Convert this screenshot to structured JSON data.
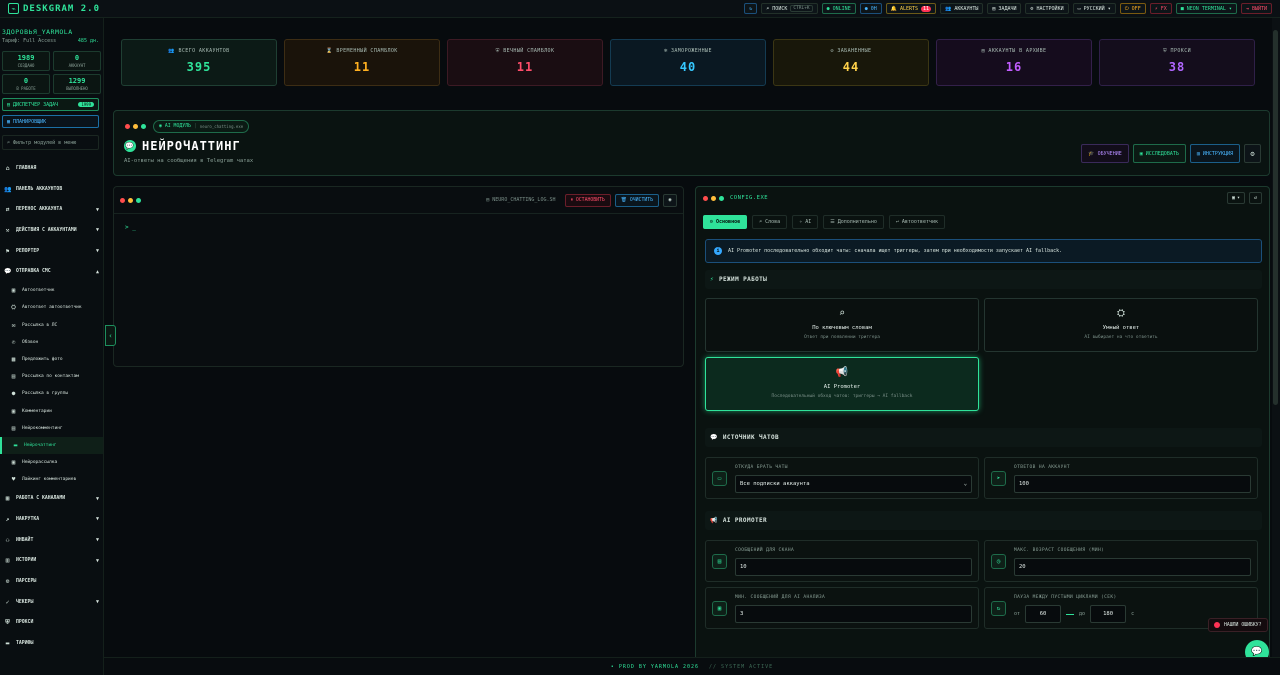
{
  "app": {
    "title": "DESKGRAM 2.0"
  },
  "topbar": {
    "refresh_icon": "refresh-icon",
    "search_label": "ПОИСК",
    "search_shortcut": "CTRL+K",
    "online": "ONLINE",
    "zero": "0Н",
    "alerts_label": "ALERTS",
    "alerts_count": "11",
    "accounts": "АККАУНТЫ",
    "tasks": "ЗАДАЧИ",
    "settings": "НАСТРОЙКИ",
    "language": "РУССКИЙ",
    "off": "OFF",
    "fx": "FX",
    "neon": "NEON TERMINAL",
    "logout": "ВЫЙТИ"
  },
  "sidebar": {
    "user_name": "ЗДОРОВЬЯ_YARMOLA",
    "tariff_label": "Тариф: Full Access",
    "tariff_days": "485 дн.",
    "stats": [
      {
        "value": "1989",
        "label": "СОЗДАНО"
      },
      {
        "value": "0",
        "label": "АККАУНТ"
      },
      {
        "value": "0",
        "label": "В РАБОТЕ"
      },
      {
        "value": "1299",
        "label": "ВЫПОЛНЕНО"
      }
    ],
    "dispatcher": "ДИСПЕТЧЕР ЗАДАЧ",
    "dispatcher_badge": "1999",
    "planner": "ПЛАНИРОВЩИК",
    "filter_placeholder": "Фильтр модулей в меню",
    "nav": [
      {
        "label": "ГЛАВНАЯ",
        "icon": "home-icon",
        "caret": ""
      },
      {
        "label": "ПАНЕЛЬ АККАУНТОВ",
        "icon": "users-icon",
        "caret": ""
      },
      {
        "label": "ПЕРЕНОС АККАУНТА",
        "icon": "transfer-icon",
        "caret": "▼"
      },
      {
        "label": "ДЕЙСТВИЯ С АККАУНТАМИ",
        "icon": "actions-icon",
        "caret": "▼"
      },
      {
        "label": "РЕПОРТЕР",
        "icon": "report-icon",
        "caret": "▼"
      },
      {
        "label": "ОТПРАВКА СМС",
        "icon": "chat-icon",
        "caret": "▲"
      }
    ],
    "sub": [
      {
        "label": "Автоответчик",
        "icon": "reply-icon"
      },
      {
        "label": "Автоответ автоответчик",
        "icon": "robot-icon"
      },
      {
        "label": "Рассылка в ЛС",
        "icon": "mail-icon"
      },
      {
        "label": "Обзвон",
        "icon": "phone-icon"
      },
      {
        "label": "Предложить фото",
        "icon": "photo-icon"
      },
      {
        "label": "Рассылка по контактам",
        "icon": "contacts-icon"
      },
      {
        "label": "Рассылка в группы",
        "icon": "group-icon"
      },
      {
        "label": "Комментарии",
        "icon": "comment-icon"
      },
      {
        "label": "Нейрокомментинг",
        "icon": "neuro-icon"
      },
      {
        "label": "Нейрочаттинг",
        "icon": "neurochat-icon",
        "active": true
      },
      {
        "label": "Нейрорассылка",
        "icon": "neuromail-icon"
      },
      {
        "label": "Лайкинг комментариев",
        "icon": "heart-icon"
      }
    ],
    "nav2": [
      {
        "label": "РАБОТА С КАНАЛАМИ",
        "icon": "channel-icon",
        "caret": "▼"
      },
      {
        "label": "НАКРУТКА",
        "icon": "chart-icon",
        "caret": "▼"
      },
      {
        "label": "ИНВАЙТ",
        "icon": "invite-icon",
        "caret": "▼"
      },
      {
        "label": "ИСТОРИИ",
        "icon": "stories-icon",
        "caret": "▼"
      },
      {
        "label": "ПАРСЕРЫ",
        "icon": "parser-icon",
        "caret": ""
      },
      {
        "label": "ЧЕКЕРЫ",
        "icon": "checker-icon",
        "caret": "▼"
      },
      {
        "label": "ПРОКСИ",
        "icon": "shield-icon",
        "caret": ""
      },
      {
        "label": "ТАРИФЫ",
        "icon": "tariff-icon",
        "caret": ""
      }
    ]
  },
  "cards": [
    {
      "title": "ВСЕГО АККАУНТОВ",
      "value": "395",
      "icon": "users-icon"
    },
    {
      "title": "ВРЕМЕННЫЙ СПАМБЛОК",
      "value": "11",
      "icon": "hourglass-icon"
    },
    {
      "title": "ВЕЧНЫЙ СПАМБЛОК",
      "value": "11",
      "icon": "shield-icon"
    },
    {
      "title": "ЗАМОРОЖЕННЫЕ",
      "value": "40",
      "icon": "snowflake-icon"
    },
    {
      "title": "ЗАБАНЕННЫЕ",
      "value": "44",
      "icon": "ban-icon"
    },
    {
      "title": "АККАУНТЫ В АРХИВЕ",
      "value": "16",
      "icon": "archive-icon"
    },
    {
      "title": "ПРОКСИ",
      "value": "38",
      "icon": "proxy-icon"
    }
  ],
  "hero": {
    "module_label": "AI МОДУЛЬ",
    "module_file": "neuro_chatting.exe",
    "title": "НЕЙРОЧАТТИНГ",
    "subtitle": "AI-ответы на сообщения в Telegram чатах",
    "btn_learn": "ОБУЧЕНИЕ",
    "btn_research": "ИССЛЕДОВАТЬ",
    "btn_manual": "ИНСТРУКЦИЯ"
  },
  "terminal": {
    "file": "NEURO_CHATTING_LOG.SH",
    "stop": "ОСТАНОВИТЬ",
    "clear": "ОЧИСТИТЬ",
    "prompt": "> _"
  },
  "config": {
    "title": "CONFIG.EXE",
    "tabs": [
      "Основное",
      "Слова",
      "AI",
      "Дополнительно",
      "Автоответчик"
    ],
    "info": "AI Promoter последовательно обходит чаты: сначала ищет триггеры, затем при необходимости запускает AI fallback.",
    "mode_section": "РЕЖИМ РАБОТЫ",
    "modes": [
      {
        "title": "По ключевым словам",
        "desc": "Ответ при появлении триггера"
      },
      {
        "title": "Умный ответ",
        "desc": "AI выбирает на что ответить"
      },
      {
        "title": "AI Promoter",
        "desc": "Последовательный обход чатов: триггеры → AI fallback"
      }
    ],
    "source_section": "ИСТОЧНИК ЧАТОВ",
    "source_label": "ОТКУДА БРАТЬ ЧАТЫ",
    "source_value": "Все подписки аккаунта",
    "replies_label": "ОТВЕТОВ НА АККАУНТ",
    "replies_value": "100",
    "promoter_section": "AI PROMOTER",
    "scan_label": "СООБЩЕНИЙ ДЛЯ СКАНА",
    "scan_value": "10",
    "age_label": "МАКС. ВОЗРАСТ СООБЩЕНИЯ (МИН)",
    "age_value": "20",
    "min_label": "МИН. СООБЩЕНИЙ ДЛЯ AI АНАЛИЗА",
    "min_value": "3",
    "pause_label": "ПАУЗА МЕЖДУ ПУСТЫМИ ЦИКЛАМИ (СЕК)",
    "pause_from_label": "от",
    "pause_from": "60",
    "pause_to_label": "до",
    "pause_to": "180",
    "pause_unit": "с"
  },
  "footer": {
    "left": "• PROD BY YARMOLA 2026",
    "right": "// SYSTEM ACTIVE"
  },
  "help": {
    "label": "НАШЛИ ОШИБКУ?"
  }
}
